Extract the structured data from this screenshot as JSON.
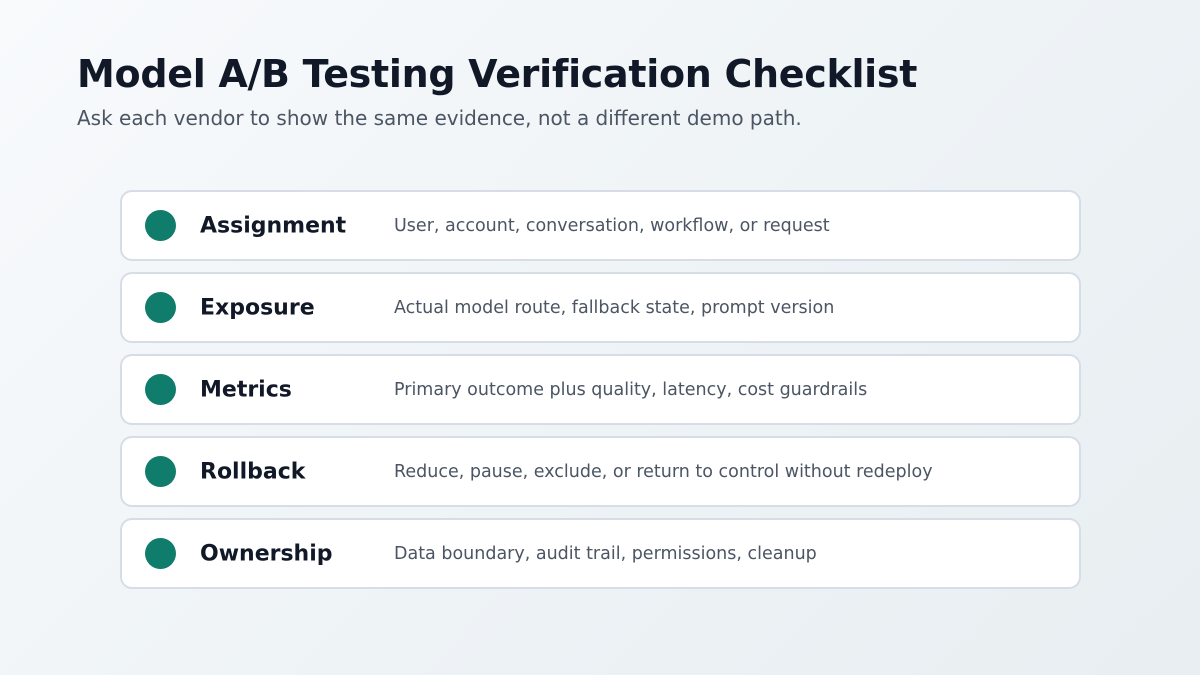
{
  "header": {
    "title": "Model A/B Testing Verification Checklist",
    "subtitle": "Ask each vendor to show the same evidence, not a different demo path."
  },
  "accent_color": "#107c6b",
  "checklist": {
    "items": [
      {
        "label": "Assignment",
        "description": "User, account, conversation, workflow, or request"
      },
      {
        "label": "Exposure",
        "description": "Actual model route, fallback state, prompt version"
      },
      {
        "label": "Metrics",
        "description": "Primary outcome plus quality, latency, cost guardrails"
      },
      {
        "label": "Rollback",
        "description": "Reduce, pause, exclude, or return to control without redeploy"
      },
      {
        "label": "Ownership",
        "description": "Data boundary, audit trail, permissions, cleanup"
      }
    ]
  }
}
